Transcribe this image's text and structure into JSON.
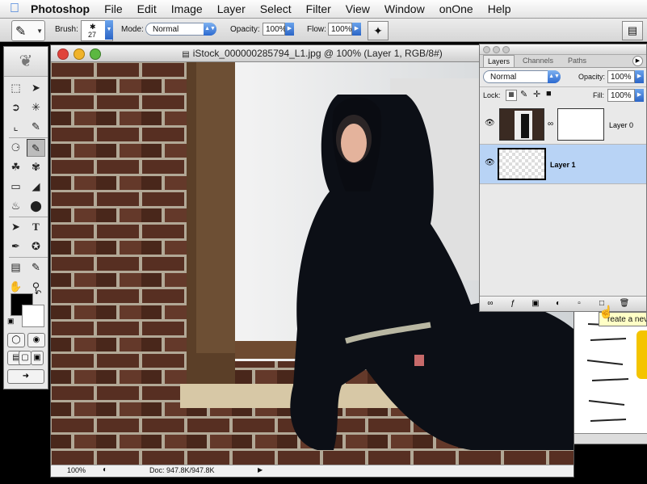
{
  "menubar": {
    "apple": "",
    "app": "Photoshop",
    "items": [
      "File",
      "Edit",
      "Image",
      "Layer",
      "Select",
      "Filter",
      "View",
      "Window",
      "onOne",
      "Help"
    ]
  },
  "options": {
    "brush_label": "Brush:",
    "brush_size": "27",
    "mode_label": "Mode:",
    "mode_value": "Normal",
    "opacity_label": "Opacity:",
    "opacity_value": "100%",
    "flow_label": "Flow:",
    "flow_value": "100%"
  },
  "document": {
    "title": "iStock_000000285794_L1.jpg @ 100% (Layer 1, RGB/8#)",
    "zoom": "100%",
    "doc_size": "Doc: 947.8K/947.8K"
  },
  "layers_panel": {
    "tabs": [
      "Layers",
      "Channels",
      "Paths"
    ],
    "blend_mode": "Normal",
    "opacity_label": "Opacity:",
    "opacity_value": "100%",
    "lock_label": "Lock:",
    "fill_label": "Fill:",
    "fill_value": "100%",
    "layers": [
      {
        "name": "Layer 0",
        "visible": true,
        "selected": false
      },
      {
        "name": "Layer 1",
        "visible": true,
        "selected": true
      }
    ]
  },
  "tooltip": "reate a nev",
  "colors": {
    "foreground": "#000000",
    "background": "#ffffff",
    "selection": "#b8d3f5",
    "mac_close": "#e0443b",
    "mac_min": "#f0b32a",
    "mac_zoom": "#5cb840"
  },
  "icons": [
    "apple-icon",
    "brush-icon",
    "airbrush-icon",
    "palette-well-icon",
    "eye-icon",
    "link-icon",
    "layer-mask-icon",
    "new-layer-icon",
    "trash-icon",
    "feather-icon"
  ]
}
